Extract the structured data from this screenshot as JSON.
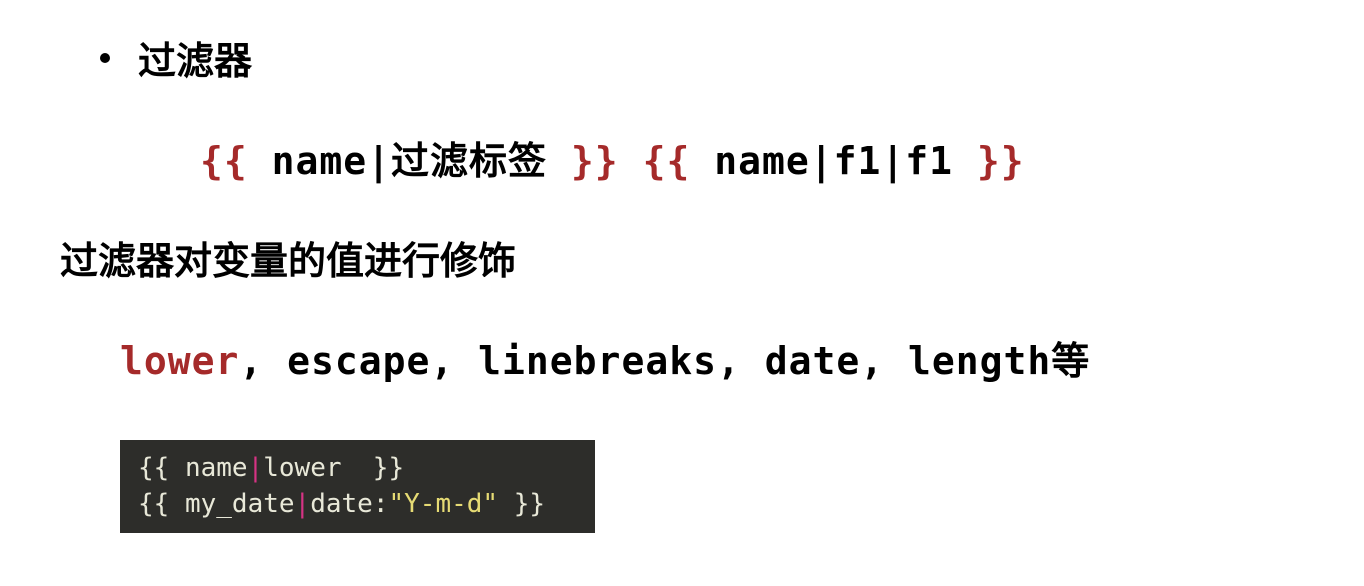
{
  "bullet": {
    "title": "过滤器"
  },
  "syntax": {
    "open1": "{{",
    "close1": "}}",
    "expr1": " name|过滤标签 ",
    "gap": "   ",
    "open2": "{{",
    "close2": "}}",
    "expr2": " name|f1|f1 "
  },
  "description": "过滤器对变量的值进行修饰",
  "filters": {
    "lower": "lower",
    "rest": ", escape, linebreaks, date, length等"
  },
  "code": {
    "line1": {
      "prefix": "{{ name",
      "pipe": "|",
      "suffix": "lower  }}"
    },
    "line2": {
      "prefix": "{{ my_date",
      "pipe": "|",
      "mid": "date:",
      "str": "\"Y-m-d\"",
      "suffix": " }}"
    }
  }
}
